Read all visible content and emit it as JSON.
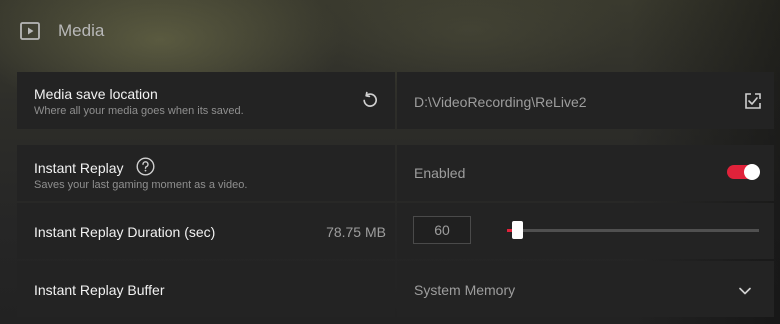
{
  "header": {
    "icon": "play-square-icon",
    "title": "Media"
  },
  "rows": [
    {
      "label": "Media save location",
      "description": "Where all your media goes when its saved.",
      "reset_icon": "reset-icon",
      "value": "D:\\VideoRecording\\ReLive2",
      "action_icon": "folder-select-icon"
    },
    {
      "label": "Instant Replay",
      "help_icon": "help-icon",
      "description": "Saves your last gaming moment as a video.",
      "value": "Enabled",
      "toggle_on": true,
      "accent_color": "#e0223a"
    },
    {
      "label": "Instant Replay Duration (sec)",
      "size": "78.75 MB",
      "input_value": "60",
      "slider_fraction": 0.04
    },
    {
      "label": "Instant Replay Buffer",
      "selected": "System Memory",
      "dropdown_icon": "chevron-down-icon"
    }
  ]
}
